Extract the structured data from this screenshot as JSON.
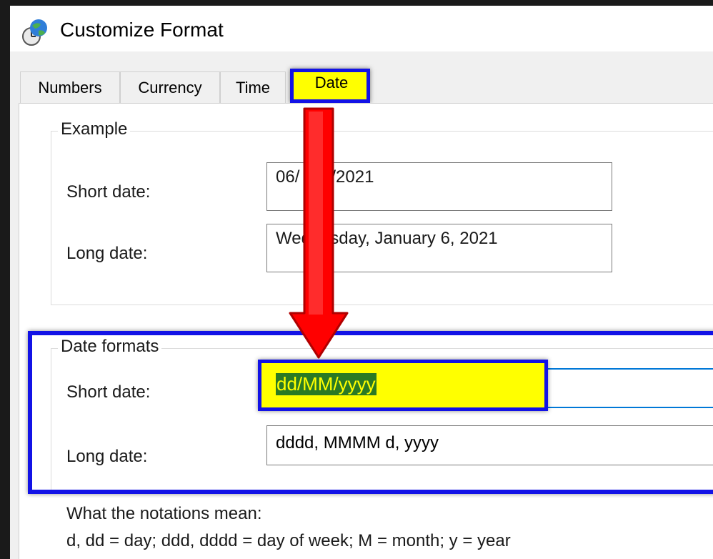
{
  "window": {
    "title": "Customize Format",
    "icon": "globe-clock-icon"
  },
  "tabs": [
    {
      "label": "Numbers"
    },
    {
      "label": "Currency"
    },
    {
      "label": "Time"
    },
    {
      "label": "Date",
      "selected": true
    }
  ],
  "example": {
    "legend": "Example",
    "short_label": "Short date:",
    "short_value": "06/01/2021",
    "short_visible_left": "06/",
    "short_visible_right": "/2021",
    "long_label": "Long date:",
    "long_value": "Wednesday, January 6, 2021",
    "long_visible_left": "Wed",
    "long_visible_right": "esday, January 6, 2021"
  },
  "date_formats": {
    "legend": "Date formats",
    "short_label": "Short date:",
    "short_value": "dd/MM/yyyy",
    "long_label": "Long date:",
    "long_value": "dddd, MMMM d, yyyy"
  },
  "notations": {
    "heading": "What the notations mean:",
    "text": "d, dd = day;  ddd, dddd = day of week;  M = month;  y = year"
  },
  "colors": {
    "annotation_blue": "#1212e6",
    "highlight_yellow": "#ffff00",
    "arrow_red": "#ff0000",
    "selection_green": "#2a7a24"
  }
}
